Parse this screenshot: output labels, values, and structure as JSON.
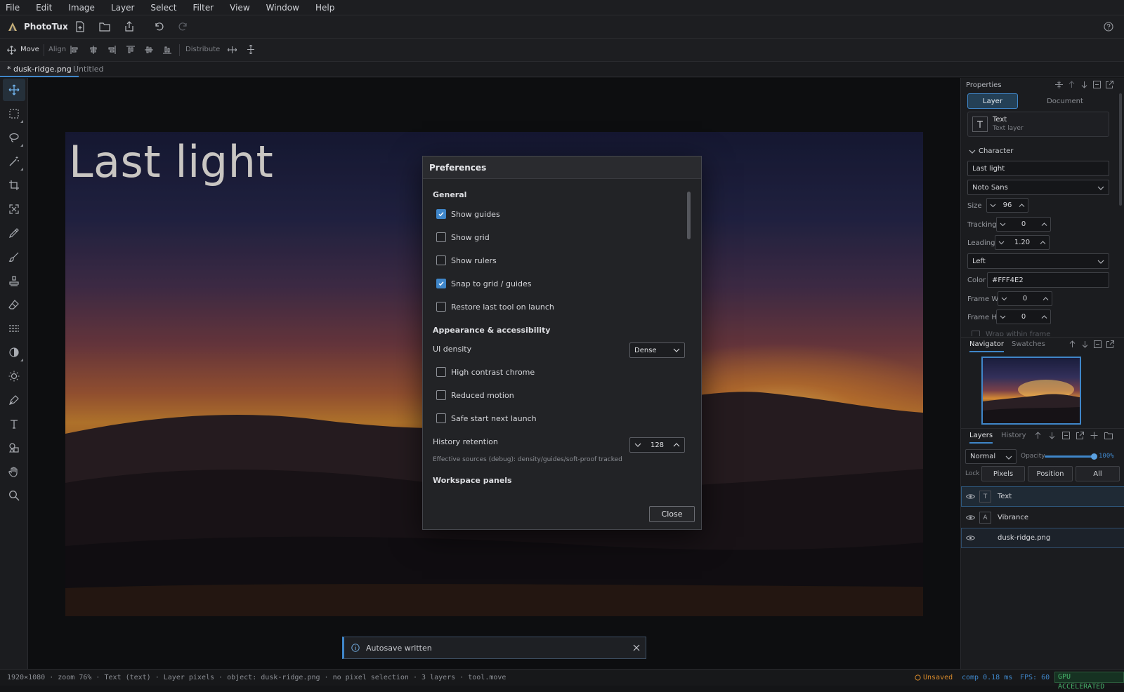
{
  "menu": [
    "File",
    "Edit",
    "Image",
    "Layer",
    "Select",
    "Filter",
    "View",
    "Window",
    "Help"
  ],
  "app": {
    "name": "PhotoTux"
  },
  "options": {
    "tool_label": "Move",
    "align_label": "Align",
    "distribute_label": "Distribute"
  },
  "tabs": [
    {
      "label": "* dusk-ridge.png",
      "active": true
    },
    {
      "label": "Untitled",
      "active": false
    }
  ],
  "canvas": {
    "text_layer_content": "Last light"
  },
  "preferences": {
    "title": "Preferences",
    "general_heading": "General",
    "show_guides": {
      "label": "Show guides",
      "checked": true
    },
    "show_grid": {
      "label": "Show grid",
      "checked": false
    },
    "show_rulers": {
      "label": "Show rulers",
      "checked": false
    },
    "snap": {
      "label": "Snap to grid / guides",
      "checked": true
    },
    "restore_tool": {
      "label": "Restore last tool on launch",
      "checked": false
    },
    "appearance_heading": "Appearance & accessibility",
    "ui_density": {
      "label": "UI density",
      "value": "Dense"
    },
    "high_contrast": {
      "label": "High contrast chrome",
      "checked": false
    },
    "reduced_motion": {
      "label": "Reduced motion",
      "checked": false
    },
    "safe_start": {
      "label": "Safe start next launch",
      "checked": false
    },
    "history_retention": {
      "label": "History retention",
      "value": "128"
    },
    "debug_note": "Effective sources (debug): density/guides/soft-proof tracked",
    "workspace_heading": "Workspace panels",
    "close_label": "Close"
  },
  "toast": {
    "message": "Autosave written"
  },
  "properties": {
    "title": "Properties",
    "tabs": {
      "layer": "Layer",
      "document": "Document"
    },
    "layer_name": "Text",
    "layer_type": "Text layer",
    "character_heading": "Character",
    "text_value": "Last light",
    "font": "Noto Sans",
    "size_label": "Size",
    "size": "96",
    "tracking_label": "Tracking",
    "tracking": "0",
    "leading_label": "Leading",
    "leading": "1.20",
    "align": "Left",
    "color_label": "Color",
    "color": "#FFF4E2",
    "frame_w_label": "Frame W",
    "frame_w": "0",
    "frame_h_label": "Frame H",
    "frame_h": "0",
    "wrap_label": "Wrap within frame"
  },
  "navigator": {
    "tab_navigator": "Navigator",
    "tab_swatches": "Swatches"
  },
  "layers": {
    "tab_layers": "Layers",
    "tab_history": "History",
    "blend_mode": "Normal",
    "opacity_label": "Opacity",
    "opacity": "100%",
    "opacity_fraction": 1.0,
    "lock_label": "Lock",
    "lock_buttons": [
      "Pixels",
      "Position",
      "All"
    ],
    "items": [
      {
        "thumb": "T",
        "name": "Text"
      },
      {
        "thumb": "A",
        "name": "Vibrance"
      },
      {
        "thumb": "",
        "name": "dusk-ridge.png"
      }
    ]
  },
  "status": {
    "left": "1920×1080 · zoom 76% · Text (text) · Layer pixels · object: dusk-ridge.png · no pixel selection · 3 layers · tool.move",
    "unsaved": "Unsaved",
    "comp": "comp 0.18 ms",
    "fps": "FPS: 60",
    "gpu": "GPU ACCELERATED"
  },
  "colors": {
    "accent": "#3f86c9",
    "background": "#141517",
    "panel": "#1b1c1f",
    "unsaved": "#d6892b",
    "gpu": "#46b36a"
  }
}
